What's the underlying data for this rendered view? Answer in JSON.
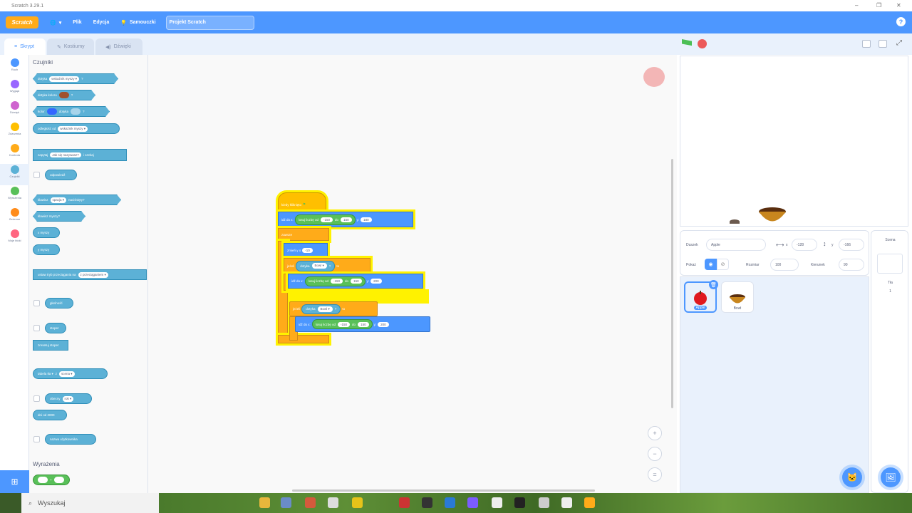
{
  "window": {
    "title": "Scratch 3.29.1"
  },
  "menubar": {
    "logo": "Scratch",
    "file": "Plik",
    "edit": "Edycja",
    "tutorials": "Samouczki",
    "project_title": "Projekt Scratch"
  },
  "tabs": {
    "code": "Skrypt",
    "costumes": "Kostiumy",
    "sounds": "Dźwięki"
  },
  "categories": [
    {
      "label": "Ruch",
      "color": "#4c97ff"
    },
    {
      "label": "Wygląd",
      "color": "#9966ff"
    },
    {
      "label": "Dźwięk",
      "color": "#cf63cf"
    },
    {
      "label": "Zdarzenia",
      "color": "#ffbf00"
    },
    {
      "label": "Kontrola",
      "color": "#ffab19"
    },
    {
      "label": "Czujniki",
      "color": "#5cb1d6"
    },
    {
      "label": "Wyrażenia",
      "color": "#59c059"
    },
    {
      "label": "Zmienne",
      "color": "#ff8c1a"
    },
    {
      "label": "Moje bloki",
      "color": "#ff6680"
    }
  ],
  "palette": {
    "sensing_heading": "Czujniki",
    "operators_heading": "Wyrażenia",
    "blocks": {
      "touching": "dotyka",
      "touching_menu": "wskaźnik myszy ▾",
      "touching_color": "dotyka koloru",
      "color_is": "kolor",
      "color_touching": "dotyka",
      "distance": "odległość od",
      "distance_menu": "wskaźnik myszy ▾",
      "ask": "zapytaj",
      "ask_default": "Jak się nazywasz?",
      "ask_wait": "i czekaj",
      "answer": "odpowiedź",
      "key": "klawisz",
      "key_menu": "spacja ▾",
      "key_pressed": "naciśnięty?",
      "mouse_down": "klawisz myszy?",
      "mouse_x": "x myszy",
      "mouse_y": "y myszy",
      "drag_mode": "ustaw tryb przeciągania na",
      "drag_menu": "z przeciąganiem ▾",
      "loudness": "głośność",
      "timer": "stoper",
      "reset_timer": "zresetuj stoper",
      "backdrop_of": "tabela tła ▾",
      "backdrop_of2": "z",
      "backdrop_stage": "scena ▾",
      "current": "obecny",
      "current_menu": "rok ▾",
      "days_since": "dni od 2000",
      "username": "nazwa użytkownika"
    }
  },
  "script": {
    "hat": "kiedy kliknięto",
    "goto1_label": "idź do x:",
    "random_label": "losuj liczbę od",
    "to_label": "do",
    "y_label": "y:",
    "goto1_from": "-150",
    "goto1_to": "150",
    "goto1_y": "180",
    "forever": "zawsze",
    "change_y": "zmień y o",
    "change_y_val": "-10",
    "if1": "jeżeli",
    "touching": "dotyka",
    "touching_target": "Bowl ▾",
    "qmark": "?",
    "then": "to",
    "goto2_from": "-150",
    "goto2_to": "150",
    "goto2_y": "200",
    "if2": "jeżeli",
    "goto3_from": "-150",
    "goto3_to": "150",
    "goto3_y": "200"
  },
  "sprite_info": {
    "sprite_label": "Duszek",
    "sprite_name": "Apple",
    "x_label": "x",
    "x_value": "-128",
    "y_label": "y",
    "y_value": "-166",
    "show_label": "Pokaż",
    "size_label": "Rozmiar",
    "size_value": "100",
    "direction_label": "Kierunek",
    "direction_value": "90"
  },
  "sprites": [
    {
      "name": "Apple",
      "selected": true
    },
    {
      "name": "Bowl",
      "selected": false
    }
  ],
  "stage_panel": {
    "title": "Scena",
    "backdrops_label": "Tła",
    "backdrops_count": "1"
  },
  "taskbar": {
    "search_placeholder": "Wyszukaj"
  }
}
